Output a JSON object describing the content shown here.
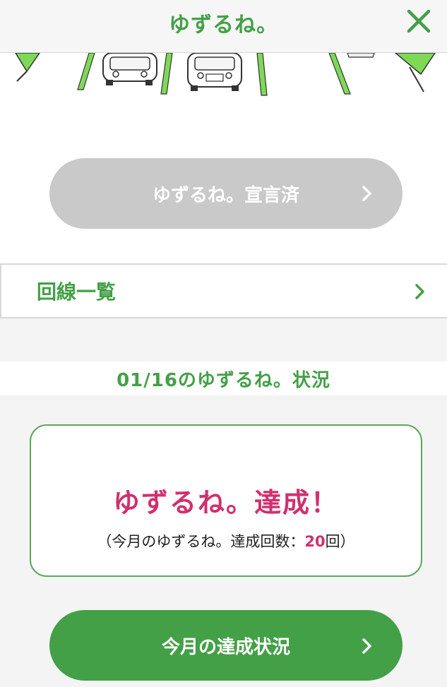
{
  "header": {
    "title": "ゆずるね。",
    "close_icon": "close-icon"
  },
  "declared_button": {
    "label": "ゆずるね。宣言済",
    "icon": "chevron-right-icon"
  },
  "line_list": {
    "label": "回線一覧",
    "icon": "chevron-right-icon"
  },
  "status": {
    "heading": "01/16のゆずるね。状況",
    "result_title": "ゆずるね。達成！",
    "result_sub_prefix": "（今月のゆずるね。達成回数：",
    "result_sub_count": "20",
    "result_sub_suffix": "回）"
  },
  "monthly_button": {
    "label": "今月の達成状況",
    "icon": "chevron-right-icon"
  },
  "colors": {
    "brand_green": "#43a047",
    "accent_pink": "#d0306e",
    "disabled_gray": "#c9c9c9"
  }
}
